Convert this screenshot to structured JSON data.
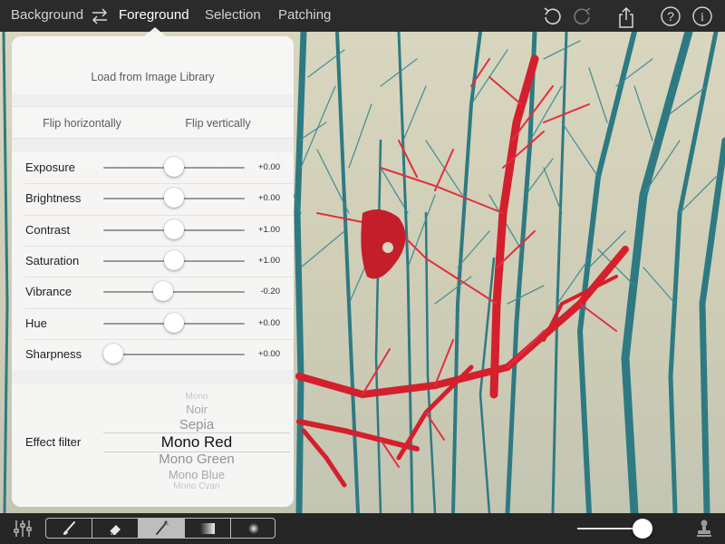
{
  "top_bar": {
    "tabs": [
      {
        "label": "Background",
        "active": false
      },
      {
        "label": "Foreground",
        "active": true
      },
      {
        "label": "Selection",
        "active": false
      },
      {
        "label": "Patching",
        "active": false
      }
    ],
    "icons": [
      "swap-icon",
      "undo-icon",
      "redo-icon",
      "share-icon",
      "help-icon",
      "info-icon"
    ]
  },
  "popover": {
    "load_label": "Load from Image Library",
    "flip_horizontal_label": "Flip horizontally",
    "flip_vertical_label": "Flip vertically",
    "sliders": [
      {
        "label": "Exposure",
        "value": "+0.00",
        "position": 0.5
      },
      {
        "label": "Brightness",
        "value": "+0.00",
        "position": 0.5
      },
      {
        "label": "Contrast",
        "value": "+1.00",
        "position": 0.5
      },
      {
        "label": "Saturation",
        "value": "+1.00",
        "position": 0.5
      },
      {
        "label": "Vibrance",
        "value": "-0.20",
        "position": 0.42
      },
      {
        "label": "Hue",
        "value": "+0.00",
        "position": 0.5
      },
      {
        "label": "Sharpness",
        "value": "+0.00",
        "position": 0.07
      }
    ],
    "effect_filter": {
      "label": "Effect filter",
      "options": [
        "Mono",
        "Noir",
        "Sepia",
        "Mono Red",
        "Mono Green",
        "Mono Blue",
        "Mono Cyan"
      ],
      "selected": "Mono Red"
    }
  },
  "bottom_bar": {
    "tools": [
      "brush-icon",
      "eraser-icon",
      "magic-wand-icon",
      "gradient-icon",
      "radial-gradient-icon"
    ],
    "selected_tool": "magic-wand-icon",
    "zoom_level": 0.9
  },
  "colors": {
    "accent_red": "#d8202e",
    "tree_cyan": "#2f7e86"
  }
}
